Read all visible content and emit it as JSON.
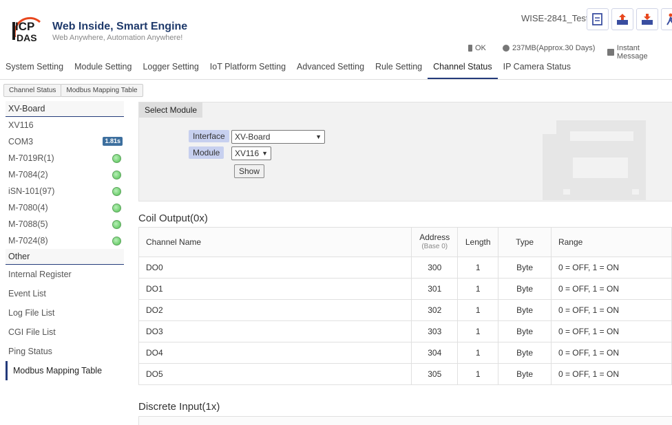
{
  "header": {
    "logo_top": "ICP",
    "logo_bottom": "DAS",
    "slogan": "Web Inside, Smart Engine",
    "subslogan": "Web Anywhere, Automation Anywhere!",
    "device_name": "WISE-2841_Test",
    "status_ok": "OK",
    "storage": "237MB(Approx.30 Days)",
    "instant_message": "Instant Message"
  },
  "nav": {
    "items": [
      "System Setting",
      "Module Setting",
      "Logger Setting",
      "IoT Platform Setting",
      "Advanced Setting",
      "Rule Setting",
      "Channel Status",
      "IP Camera Status"
    ],
    "active": "Channel Status"
  },
  "breadcrumb": [
    "Channel Status",
    "Modbus Mapping Table"
  ],
  "sidebar": {
    "group1": "XV-Board",
    "xv116": "XV116",
    "com3": "COM3",
    "com3_badge": "1.81s",
    "modules": [
      "M-7019R(1)",
      "M-7084(2)",
      "iSN-101(97)",
      "M-7080(4)",
      "M-7088(5)",
      "M-7024(8)"
    ],
    "group2": "Other",
    "other": [
      "Internal Register",
      "Event List",
      "Log File List",
      "CGI File List",
      "Ping Status",
      "Modbus Mapping Table"
    ]
  },
  "select_module": {
    "title": "Select Module",
    "interface_label": "Interface",
    "interface_value": "XV-Board",
    "module_label": "Module",
    "module_value": "XV116",
    "show_button": "Show"
  },
  "coil": {
    "title": "Coil Output(0x)",
    "headers": {
      "name": "Channel Name",
      "address": "Address",
      "address_sub": "(Base 0)",
      "length": "Length",
      "type": "Type",
      "range": "Range"
    },
    "rows": [
      {
        "name": "DO0",
        "address": "300",
        "length": "1",
        "type": "Byte",
        "range": "0 = OFF, 1 = ON"
      },
      {
        "name": "DO1",
        "address": "301",
        "length": "1",
        "type": "Byte",
        "range": "0 = OFF, 1 = ON"
      },
      {
        "name": "DO2",
        "address": "302",
        "length": "1",
        "type": "Byte",
        "range": "0 = OFF, 1 = ON"
      },
      {
        "name": "DO3",
        "address": "303",
        "length": "1",
        "type": "Byte",
        "range": "0 = OFF, 1 = ON"
      },
      {
        "name": "DO4",
        "address": "304",
        "length": "1",
        "type": "Byte",
        "range": "0 = OFF, 1 = ON"
      },
      {
        "name": "DO5",
        "address": "305",
        "length": "1",
        "type": "Byte",
        "range": "0 = OFF, 1 = ON"
      }
    ]
  },
  "discrete": {
    "title": "Discrete Input(1x)"
  }
}
